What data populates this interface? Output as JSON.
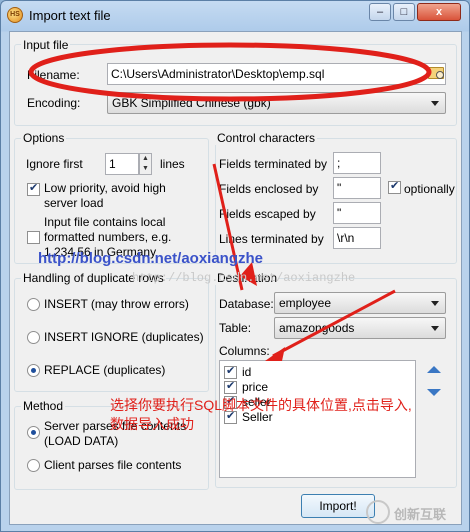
{
  "window": {
    "title": "Import text file",
    "controls": [
      "–",
      "□",
      "x"
    ],
    "app_icon_text": "HS"
  },
  "input_file": {
    "group_title": "Input file",
    "filename_label": "Filename:",
    "filename_value": "C:\\Users\\Administrator\\Desktop\\emp.sql",
    "encoding_label": "Encoding:",
    "encoding_value": "GBK Simplified Chinese (gbk)"
  },
  "options": {
    "group_title": "Options",
    "ignore_first_label": "Ignore first",
    "ignore_first_value": "1",
    "lines_label": "lines",
    "low_priority_label": "Low priority, avoid high server load",
    "low_priority_checked": true,
    "contains_local_label": "Input file contains local formatted numbers, e.g. 1,234.56 in Germany",
    "contains_local_checked": false
  },
  "control_characters": {
    "group_title": "Control characters",
    "fields_terminated_label": "Fields terminated by",
    "fields_terminated_value": ";",
    "fields_enclosed_label": "Fields enclosed by",
    "fields_enclosed_value": "\"",
    "optionally_label": "optionally",
    "optionally_checked": true,
    "fields_escaped_label": "Fields escaped by",
    "fields_escaped_value": "\"",
    "lines_terminated_label": "Lines terminated by",
    "lines_terminated_value": "\\r\\n"
  },
  "duplicates": {
    "group_title": "Handling of duplicate rows",
    "options": [
      "INSERT (may throw errors)",
      "INSERT IGNORE (duplicates)",
      "REPLACE (duplicates)"
    ],
    "selected_index": 2
  },
  "destination": {
    "group_title": "Destination",
    "database_label": "Database:",
    "database_value": "employee",
    "table_label": "Table:",
    "table_value": "amazongoods",
    "columns_label": "Columns:",
    "columns": [
      {
        "name": "id",
        "checked": true
      },
      {
        "name": "price",
        "checked": true
      },
      {
        "name": "seller",
        "checked": true
      },
      {
        "name": "Seller",
        "checked": true
      }
    ]
  },
  "method": {
    "group_title": "Method",
    "options": [
      "Server parses file contents (LOAD DATA)",
      "Client parses file contents"
    ],
    "selected_index": 0
  },
  "buttons": {
    "import_label": "Import!"
  },
  "overlays": {
    "watermark_url": "http://blog.csdn.net/aoxiangzhe",
    "watermark_faint": "http://blog.csdn.net/aoxiangzhe",
    "annotation_line1": "选择你要执行SQL脚本文件的具体位置,点击导入,",
    "annotation_line2": "数据导入成功",
    "annotation_color": "#e0201a",
    "logo_text": "创新互联"
  },
  "icons": [
    "app-icon",
    "folder-icon",
    "arrow-up-icon",
    "arrow-down-icon",
    "chevron-down-icon"
  ],
  "colors": {
    "accent": "#3a77c4",
    "annotation": "#e0201a"
  }
}
